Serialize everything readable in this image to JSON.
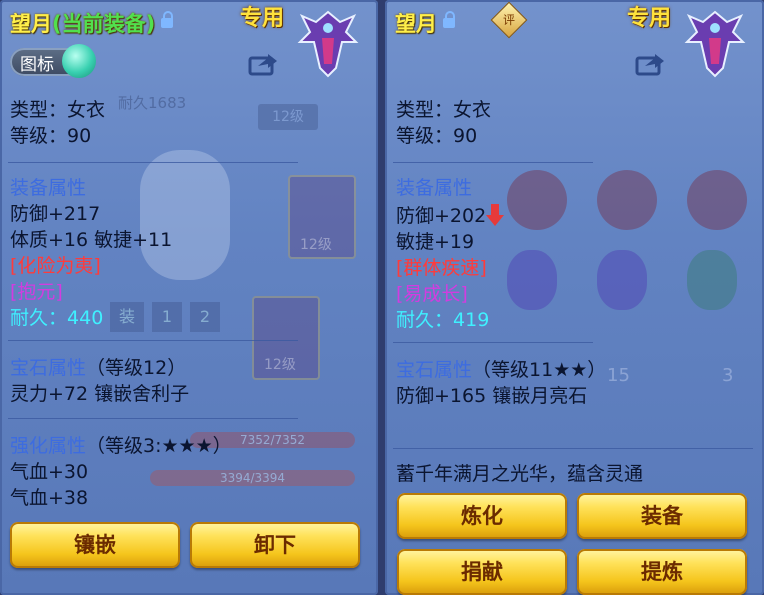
{
  "left": {
    "name": "望月",
    "current": "(当前装备)",
    "exclusive": "专用",
    "toggle_label": "图标",
    "type_line": "类型：女衣",
    "level_line": "等级：90",
    "equip_header": "装备属性",
    "stats": [
      "防御+217",
      "体质+16 敏捷+11"
    ],
    "skill1": "[化险为夷]",
    "skill2": "[抱元]",
    "durability_label": "耐久：",
    "durability_value": "440",
    "gem_header": "宝石属性",
    "gem_level": "（等级12）",
    "gem_line": "灵力+72 镶嵌舍利子",
    "enhance_header": "强化属性",
    "enhance_level": "（等级3:★★★）",
    "enhance_lines": [
      "气血+30",
      "气血+38"
    ],
    "btn_inlay": "镶嵌",
    "btn_unequip": "卸下",
    "bg_text": [
      "耐久1683",
      "12级",
      "12级",
      "12级",
      "装",
      "1",
      "2",
      "3394/3394",
      "7352/7352"
    ]
  },
  "right": {
    "name": "望月",
    "exclusive": "专用",
    "eval": "评",
    "type_line": "类型：女衣",
    "level_line": "等级：90",
    "equip_header": "装备属性",
    "stat1": "防御+202",
    "stat2": "敏捷+19",
    "skill1": "[群体疾速]",
    "skill2": "[易成长]",
    "durability_label": "耐久：",
    "durability_value": "419",
    "gem_header": "宝石属性",
    "gem_level": "（等级11★★）",
    "gem_line": "防御+165 镶嵌月亮石",
    "desc": "蓄千年满月之光华，蕴含灵通",
    "btn_refine": "炼化",
    "btn_equip": "装备",
    "btn_donate": "捐献",
    "btn_extract": "提炼",
    "bg_text": [
      "15",
      "3"
    ]
  },
  "colors": {
    "title_yellow": "#ffef4a",
    "current_green": "#51e04d",
    "header_blue": "#3d6ce0",
    "skill_red": "#ff3b3b",
    "skill_pink": "#d23ce0",
    "durability_cyan": "#3ff0ff",
    "down_arrow": "#e63a3a"
  }
}
